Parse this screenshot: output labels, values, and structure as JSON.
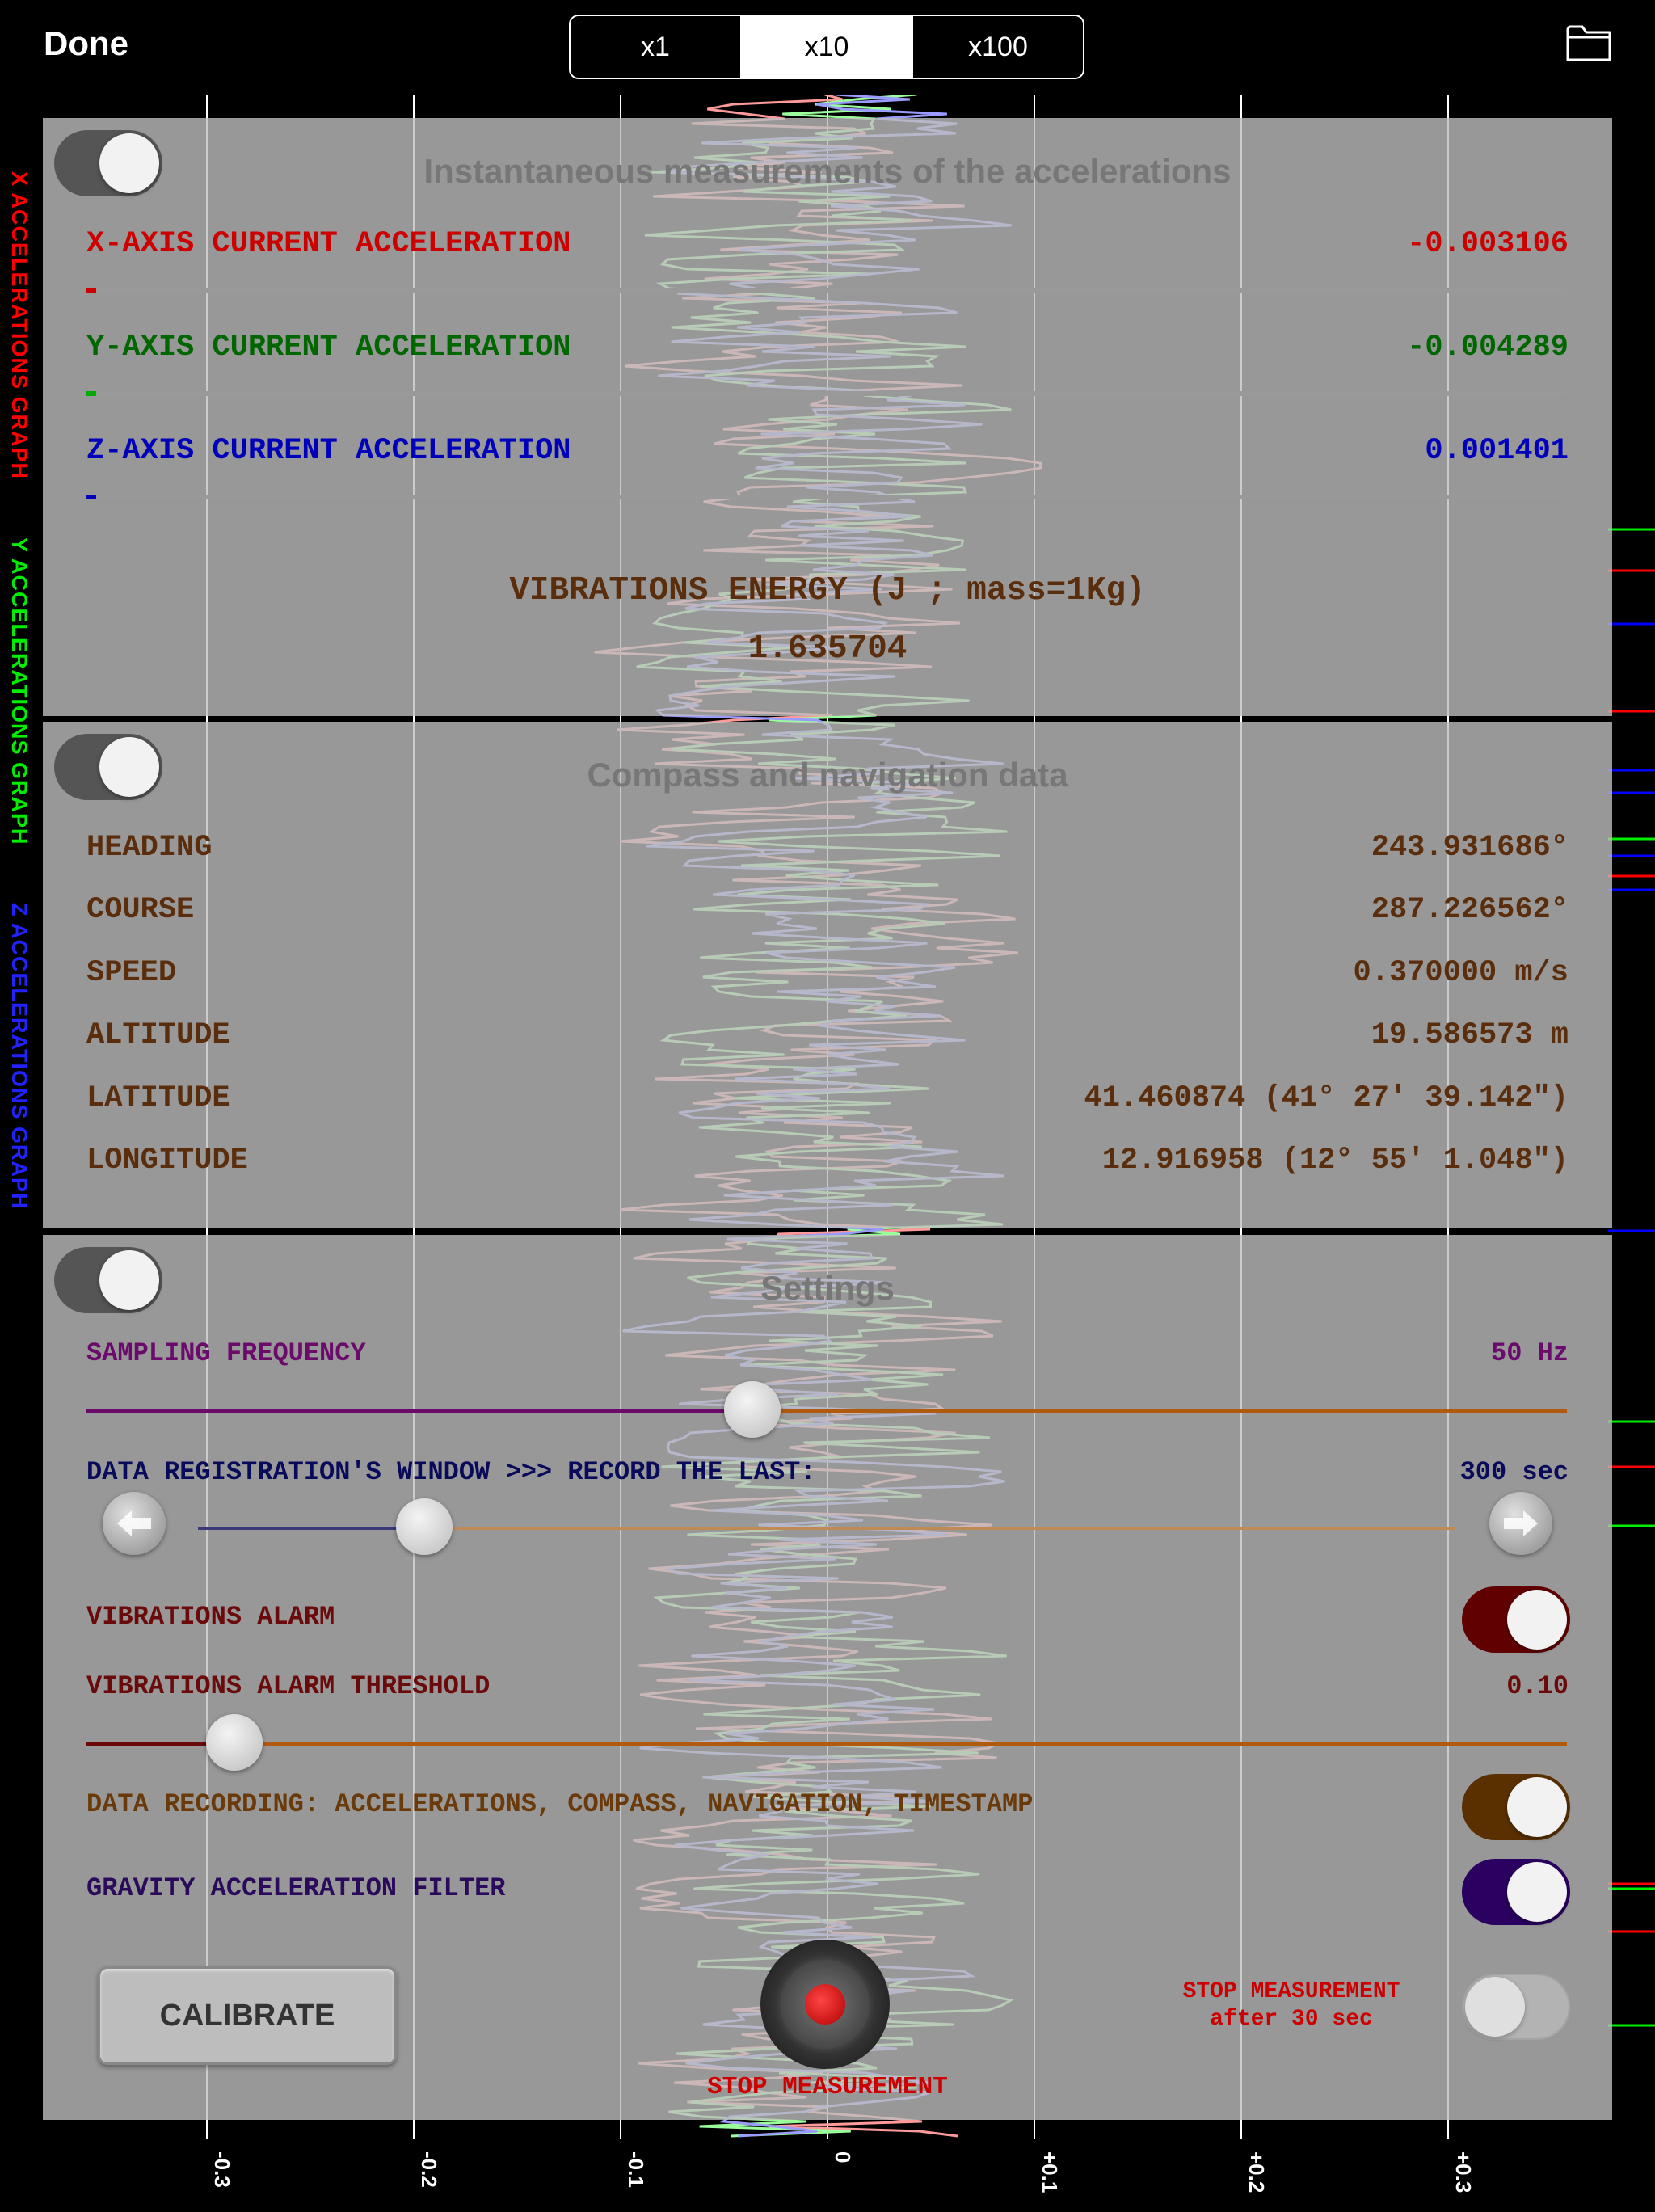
{
  "topbar": {
    "done_label": "Done",
    "scales": [
      "x1",
      "x10",
      "x100"
    ],
    "selected_scale": "x10",
    "folder_icon": "folder-icon"
  },
  "graph": {
    "side_labels": {
      "x": "X ACCELERATIONS GRAPH",
      "y": "Y ACCELERATIONS GRAPH",
      "z": "Z ACCELERATIONS GRAPH"
    },
    "axis_ticks": [
      "-0.3",
      "-0.2",
      "-0.1",
      "0",
      "+0.1",
      "+0.2",
      "+0.3"
    ],
    "colors": {
      "x": "#ff0000",
      "y": "#00ee00",
      "z": "#0000ff"
    }
  },
  "acceleration": {
    "title": "Instantaneous measurements of the accelerations",
    "toggle_on": true,
    "x": {
      "label": "X-AXIS CURRENT ACCELERATION",
      "value": "-0.003106",
      "color": "#cc0000"
    },
    "y": {
      "label": "Y-AXIS CURRENT ACCELERATION",
      "value": "-0.004289",
      "color": "#006600"
    },
    "z": {
      "label": "Z-AXIS CURRENT ACCELERATION",
      "value": "0.001401",
      "color": "#0000bb"
    },
    "energy_label": "VIBRATIONS ENERGY (J ; mass=1Kg)",
    "energy_value": "1.635704"
  },
  "compass": {
    "title": "Compass and navigation data",
    "toggle_on": true,
    "rows": [
      {
        "label": "HEADING",
        "value": "243.931686°"
      },
      {
        "label": "COURSE",
        "value": "287.226562°"
      },
      {
        "label": "SPEED",
        "value": "0.370000 m/s"
      },
      {
        "label": "ALTITUDE",
        "value": "19.586573 m"
      },
      {
        "label": "LATITUDE",
        "value": "41.460874 (41° 27' 39.142\")"
      },
      {
        "label": "LONGITUDE",
        "value": "12.916958 (12° 55' 1.048\")"
      }
    ]
  },
  "settings": {
    "title": "Settings",
    "toggle_on": true,
    "sampling_label": "SAMPLING FREQUENCY",
    "sampling_value": "50 Hz",
    "sampling_fraction": 0.45,
    "window_label": "DATA REGISTRATION'S WINDOW >>> RECORD THE LAST:",
    "window_value": "300 sec",
    "window_fraction": 0.18,
    "alarm_label": "VIBRATIONS ALARM",
    "alarm_on": true,
    "threshold_label": "VIBRATIONS ALARM THRESHOLD",
    "threshold_value": "0.10",
    "threshold_fraction": 0.1,
    "recording_label": "DATA RECORDING: ACCELERATIONS, COMPASS, NAVIGATION, TIMESTAMP",
    "recording_on": true,
    "gravity_label": "GRAVITY ACCELERATION FILTER",
    "gravity_on": true,
    "calibrate_label": "CALIBRATE",
    "stop_label": "STOP MEASUREMENT",
    "stop_after_line1": "STOP MEASUREMENT",
    "stop_after_line2": "after 30 sec",
    "stop_after_on": false
  }
}
